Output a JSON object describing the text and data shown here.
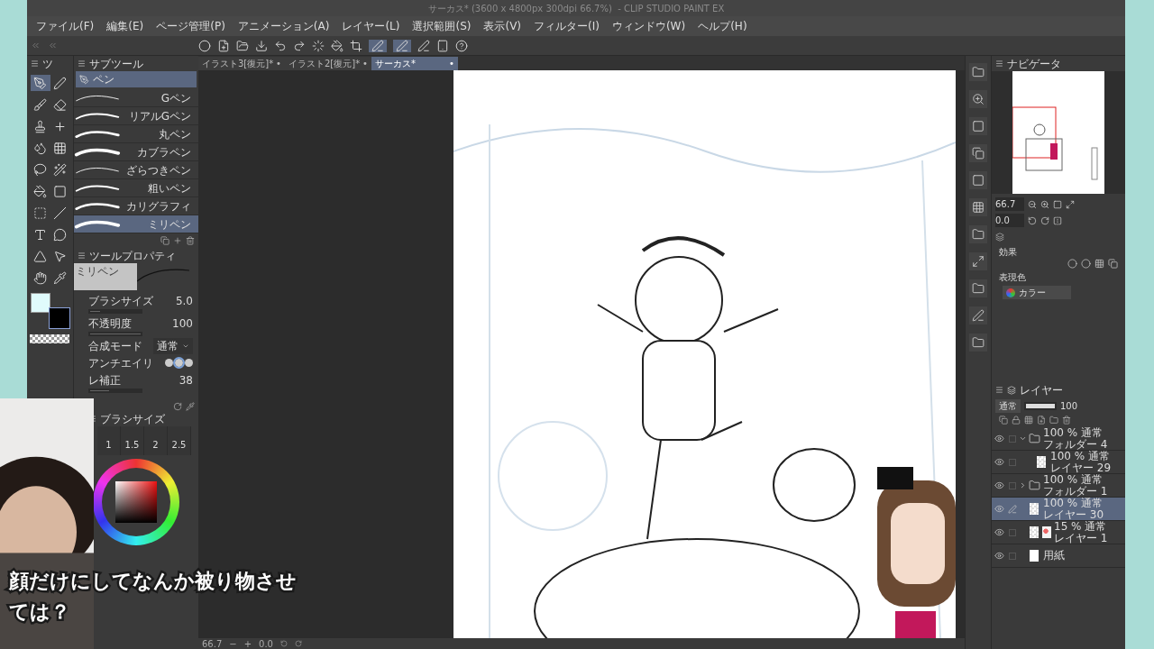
{
  "window": {
    "title": "サーカス* (3600 x 4800px 300dpi 66.7%)  - CLIP STUDIO PAINT EX"
  },
  "menu": [
    "ファイル(F)",
    "編集(E)",
    "ページ管理(P)",
    "アニメーション(A)",
    "レイヤー(L)",
    "選択範囲(S)",
    "表示(V)",
    "フィルター(I)",
    "ウィンドウ(W)",
    "ヘルプ(H)"
  ],
  "doc_tabs": [
    {
      "label": "イラスト3[復元]*",
      "mark": "•",
      "selected": false
    },
    {
      "label": "イラスト2[復元]*",
      "mark": "•",
      "selected": false
    },
    {
      "label": "サーカス*",
      "mark": "•",
      "selected": true
    }
  ],
  "tool_panel": {
    "tab": "ツ"
  },
  "sub_tool": {
    "tab": "サブツール",
    "group": "ペン",
    "brushes": [
      {
        "name": "Gペン",
        "selected": false
      },
      {
        "name": "リアルGペン",
        "selected": false
      },
      {
        "name": "丸ペン",
        "selected": false
      },
      {
        "name": "カブラペン",
        "selected": false
      },
      {
        "name": "ざらつきペン",
        "selected": false
      },
      {
        "name": "粗いペン",
        "selected": false
      },
      {
        "name": "カリグラフィ",
        "selected": false
      },
      {
        "name": "ミリペン",
        "selected": true
      }
    ]
  },
  "tool_property": {
    "tab": "ツールプロパティ",
    "preview_label": "ミリペン",
    "rows": [
      {
        "kind": "number",
        "label": "ブラシサイズ",
        "value": "5.0",
        "level": 0.2
      },
      {
        "kind": "number",
        "label": "不透明度",
        "value": "100",
        "level": 1
      },
      {
        "kind": "select",
        "label": "合成モード",
        "value": "通常"
      },
      {
        "kind": "antialias",
        "label": "アンチエイリ"
      },
      {
        "kind": "number",
        "label": "レ補正",
        "value": "38",
        "level": 0.38
      }
    ]
  },
  "brush_size": {
    "tab": "ブラシサイズ",
    "values": [
      "1",
      "1.5",
      "2",
      "2.5"
    ]
  },
  "navigator": {
    "tab": "ナビゲータ",
    "zoom": "66.7",
    "angle": "0.0"
  },
  "layer_property": {
    "effect_label": "効果",
    "color_label": "表現色",
    "color_mode": "カラー"
  },
  "layers": {
    "tab": "レイヤー",
    "blend": "通常",
    "opacity": {
      "value": "100",
      "level": 1
    },
    "items": [
      {
        "kind": "folder",
        "mode": "100 % 通常",
        "name": "フォルダー 4",
        "selected": false,
        "expanded": true,
        "children": [
          {
            "kind": "raster",
            "mode": "100 % 通常",
            "name": "レイヤー 29",
            "selected": false
          }
        ]
      },
      {
        "kind": "folder",
        "mode": "100 % 通常",
        "name": "フォルダー 1",
        "selected": false,
        "expanded": false
      },
      {
        "kind": "raster",
        "mode": "100 % 通常",
        "name": "レイヤー 30",
        "selected": true
      },
      {
        "kind": "masked",
        "mode": "15 % 通常",
        "name": "レイヤー 1",
        "selected": false
      },
      {
        "kind": "paper",
        "name": "用紙",
        "selected": false
      }
    ]
  },
  "status_bar": {
    "zoom": "66.7",
    "angle": "0.0",
    "minus": "−",
    "plus": "+"
  },
  "caption": {
    "lines": [
      "顔だけにしてなんか被り物させ",
      "ては？"
    ]
  }
}
